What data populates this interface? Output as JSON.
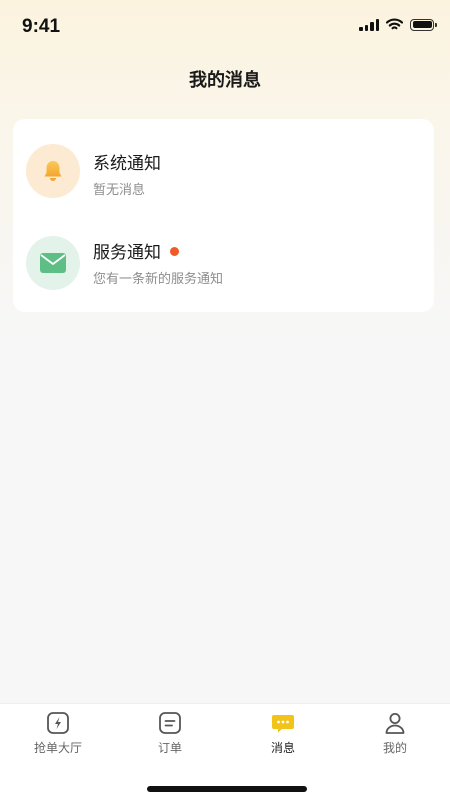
{
  "status_bar": {
    "time": "9:41"
  },
  "header": {
    "title": "我的消息"
  },
  "messages": [
    {
      "title": "系统通知",
      "subtitle": "暂无消息",
      "icon": "bell-icon",
      "unread": false
    },
    {
      "title": "服务通知",
      "subtitle": "您有一条新的服务通知",
      "icon": "mail-icon",
      "unread": true
    }
  ],
  "tabbar": {
    "items": [
      {
        "label": "抢单大厅",
        "icon": "lightning-square-icon",
        "active": false
      },
      {
        "label": "订单",
        "icon": "list-square-icon",
        "active": false
      },
      {
        "label": "消息",
        "icon": "message-bubble-icon",
        "active": true
      },
      {
        "label": "我的",
        "icon": "user-icon",
        "active": false
      }
    ]
  },
  "colors": {
    "accent": "#f2c318",
    "unread_dot": "#ef5a26",
    "bell": "#f6b33e",
    "mail": "#5ebf86"
  }
}
